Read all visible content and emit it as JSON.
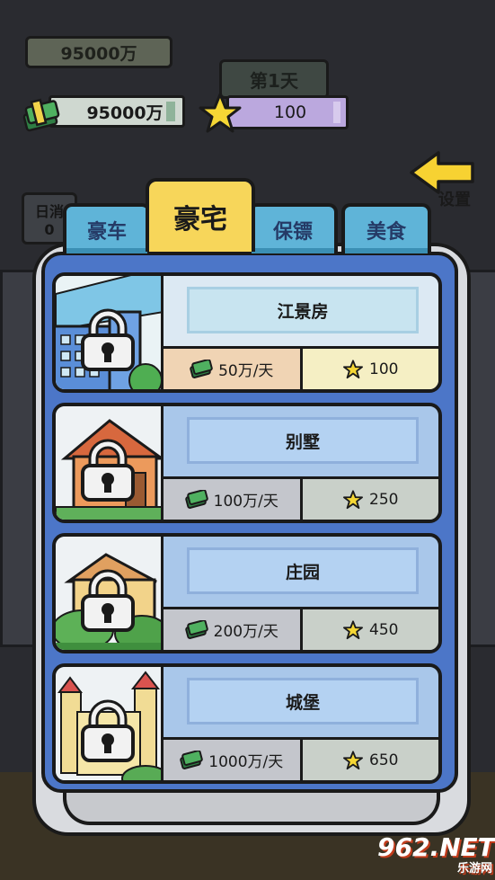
{
  "background": {
    "money_shadow": "95000万",
    "day_label": "第1天",
    "stars_shadow": "100",
    "daily_label": "日消",
    "daily_value": "0",
    "settings_label": "设置"
  },
  "hud": {
    "money": "95000万",
    "stars": "100"
  },
  "tabs": [
    {
      "label": "豪车",
      "active": false
    },
    {
      "label": "豪宅",
      "active": true
    },
    {
      "label": "保镖",
      "active": false
    },
    {
      "label": "美食",
      "active": false
    }
  ],
  "items": [
    {
      "name": "江景房",
      "income": "50万/天",
      "stars": "100",
      "locked": true,
      "scene": "river-apartment"
    },
    {
      "name": "别墅",
      "income": "100万/天",
      "stars": "250",
      "locked": true,
      "scene": "villa"
    },
    {
      "name": "庄园",
      "income": "200万/天",
      "stars": "450",
      "locked": true,
      "scene": "manor"
    },
    {
      "name": "城堡",
      "income": "1000万/天",
      "stars": "650",
      "locked": true,
      "scene": "castle"
    }
  ],
  "watermark": {
    "text": "962.NET",
    "sub": "乐游网"
  },
  "colors": {
    "panel_blue": "#4c76c8",
    "tab_active": "#f7d65a",
    "tab_inactive": "#5fb4d8",
    "star_yellow": "#f5d735",
    "cash_green": "#3fa05a"
  }
}
